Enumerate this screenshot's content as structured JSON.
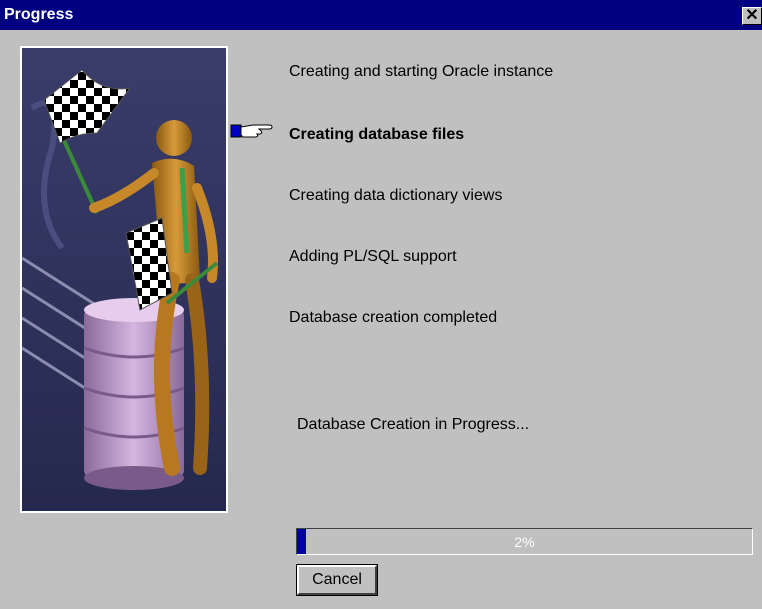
{
  "window": {
    "title": "Progress",
    "close_glyph": "✕"
  },
  "steps": [
    {
      "label": "Creating and starting Oracle instance",
      "current": false
    },
    {
      "label": "Creating database files",
      "current": true
    },
    {
      "label": "Creating data dictionary views",
      "current": false
    },
    {
      "label": "Adding PL/SQL support",
      "current": false
    },
    {
      "label": "Database creation completed",
      "current": false
    }
  ],
  "current_step_icon": "pointing-hand-icon",
  "status_text": "Database Creation in Progress...",
  "progress": {
    "value_percent": 2,
    "label": "2%"
  },
  "cancel_label": "Cancel",
  "colors": {
    "titlebar": "#000080",
    "progress_fill": "#0000a0",
    "background": "#c0c0c0"
  }
}
